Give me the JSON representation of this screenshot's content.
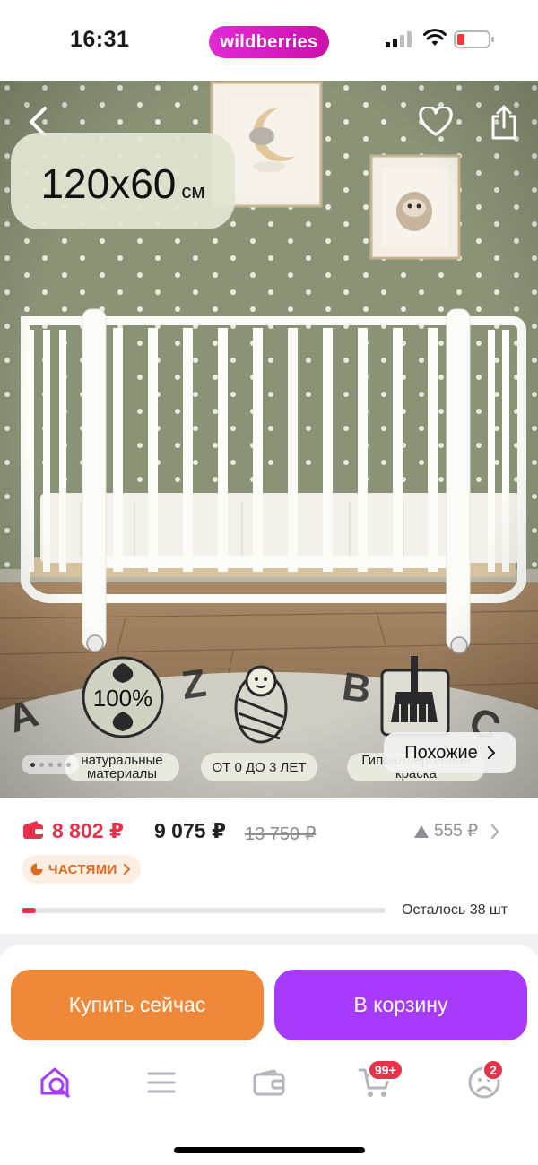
{
  "status_bar": {
    "time": "16:31",
    "brand": "wildberries"
  },
  "hero": {
    "size_value": "120x60",
    "size_unit": "см",
    "features": [
      {
        "icon": "leaf-icon",
        "badge": "100%",
        "label": "натуральные материалы"
      },
      {
        "icon": "swaddled-baby-icon",
        "label": "ОТ 0 ДО 3 ЛЕТ"
      },
      {
        "icon": "paint-brush-icon",
        "label": "Гипоаллергенная краска"
      }
    ],
    "similar_label": "Похожие",
    "pager": {
      "total": 5,
      "current": 1
    }
  },
  "price": {
    "wallet_price": "8 802 ₽",
    "regular_price": "9 075 ₽",
    "old_price": "13 750 ₽",
    "price_drop": "555 ₽"
  },
  "installments_label": "ЧАСТЯМИ",
  "stock": {
    "label": "Осталось 38 шт",
    "level": 0.04
  },
  "actions": {
    "buy_now": "Купить сейчас",
    "add_to_cart": "В корзину"
  },
  "tab_bar": {
    "items": [
      {
        "name": "home-search",
        "icon": "home-search-icon",
        "active": true
      },
      {
        "name": "catalog",
        "icon": "menu-icon"
      },
      {
        "name": "wallet",
        "icon": "wallet-icon"
      },
      {
        "name": "cart",
        "icon": "cart-icon",
        "badge": "99+"
      },
      {
        "name": "profile",
        "icon": "profile-icon",
        "badge": "2"
      }
    ]
  },
  "colors": {
    "brand": "#cb11ab",
    "wallet_price": "#e8324c",
    "buy_now": "#f0883a",
    "add_to_cart": "#a73afd",
    "tab_active": "#a73afd",
    "tab_inactive": "#b5b5bd"
  }
}
